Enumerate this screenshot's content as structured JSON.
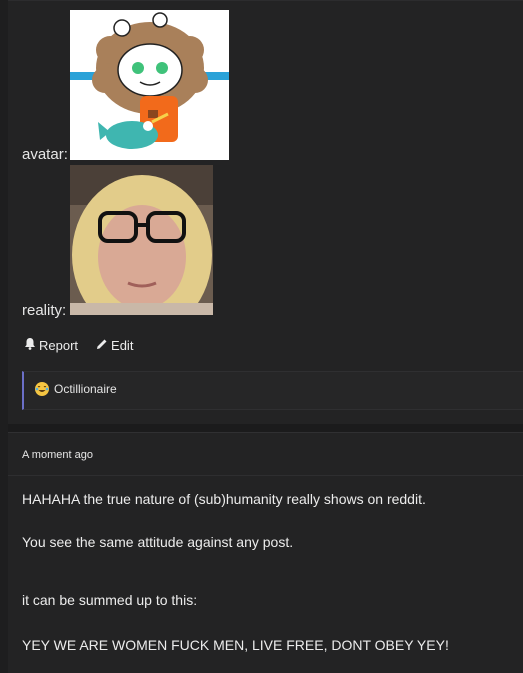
{
  "post": {
    "avatar_label": "avatar:",
    "reality_label": "reality:",
    "actions": {
      "report_label": "Report",
      "edit_label": "Edit"
    },
    "flair": {
      "text": "Octillionaire",
      "icon": "laughing-emoji-icon"
    }
  },
  "comment": {
    "timestamp": "A moment ago",
    "paragraphs": [
      "HAHAHA the true nature of (sub)humanity really shows on reddit.",
      "You see the same attitude against any post.",
      "it can be summed up to this:",
      "YEY WE ARE WOMEN FUCK MEN, LIVE FREE, DONT OBEY YEY!"
    ]
  },
  "colors": {
    "background": "#1e1e1f",
    "card": "#232324",
    "accent": "#6b6fc7",
    "text": "#e6e6e6"
  }
}
